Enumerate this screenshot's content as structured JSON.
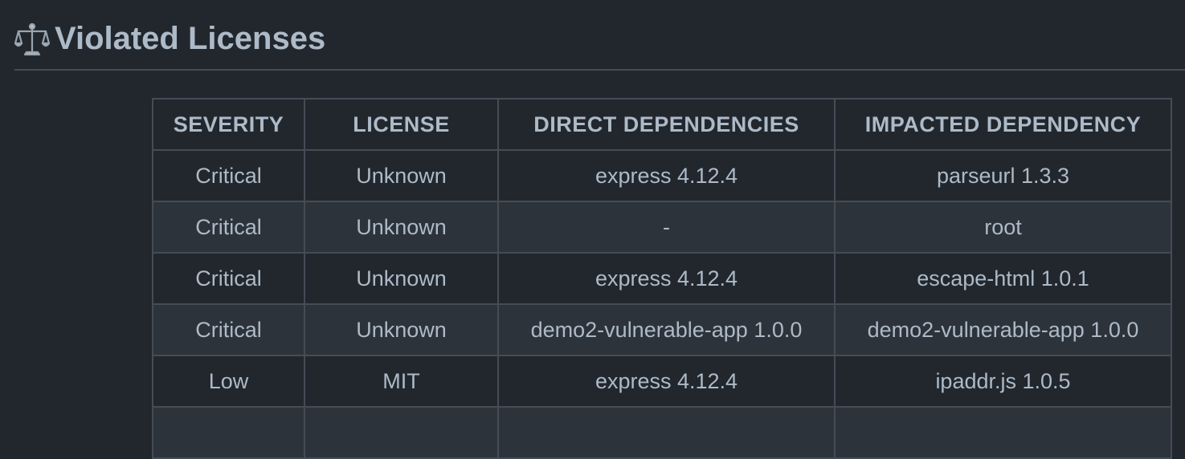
{
  "heading": {
    "icon": "balance-scale-icon",
    "title": "Violated Licenses"
  },
  "table": {
    "headers": [
      "SEVERITY",
      "LICENSE",
      "DIRECT DEPENDENCIES",
      "IMPACTED DEPENDENCY"
    ],
    "rows": [
      [
        "Critical",
        "Unknown",
        "express 4.12.4",
        "parseurl 1.3.3"
      ],
      [
        "Critical",
        "Unknown",
        "-",
        "root"
      ],
      [
        "Critical",
        "Unknown",
        "express 4.12.4",
        "escape-html 1.0.1"
      ],
      [
        "Critical",
        "Unknown",
        "demo2-vulnerable-app 1.0.0",
        "demo2-vulnerable-app 1.0.0"
      ],
      [
        "Low",
        "MIT",
        "express 4.12.4",
        "ipaddr.js 1.0.5"
      ],
      [
        "",
        "",
        "",
        ""
      ]
    ]
  },
  "colors": {
    "background": "#22272e",
    "row_alt": "#2d333b",
    "border": "#444c56",
    "text": "#adbac7"
  }
}
